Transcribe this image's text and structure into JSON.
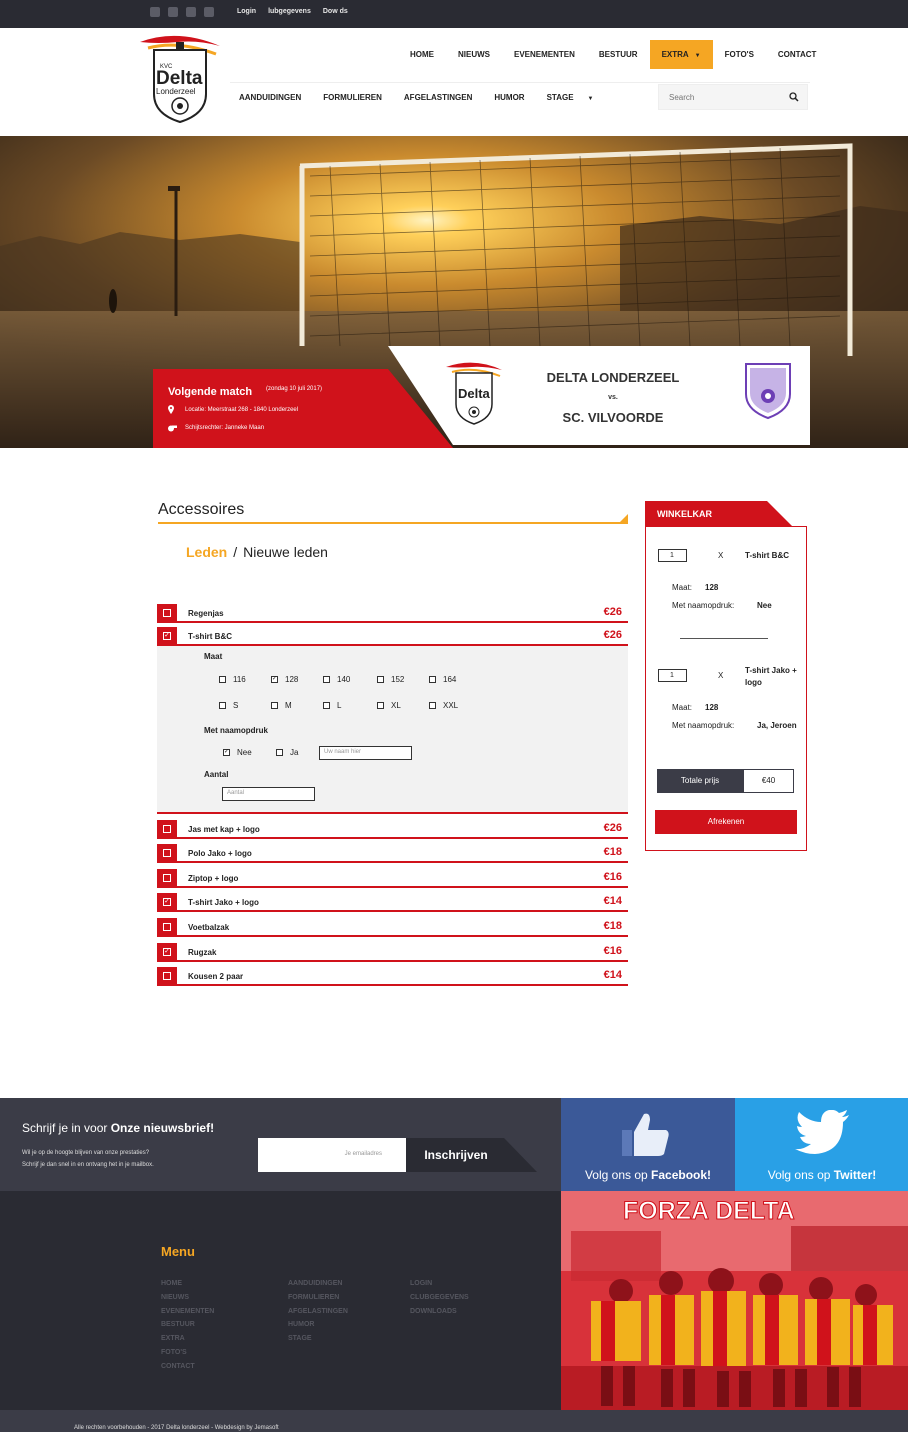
{
  "topbar": {
    "social": [
      "facebook-icon",
      "twitter-icon",
      "instagram-icon",
      "youtube-icon"
    ],
    "links": [
      "Login",
      "lubgegevens",
      "Dow   ds"
    ]
  },
  "nav": {
    "main": [
      "HOME",
      "NIEUWS",
      "EVENEMENTEN",
      "BESTUUR",
      "EXTRA",
      "FOTO'S",
      "CONTACT"
    ],
    "active": "EXTRA",
    "sub": [
      "AANDUIDINGEN",
      "FORMULIEREN",
      "AFGELASTINGEN",
      "HUMOR",
      "STAGE"
    ]
  },
  "search": {
    "placeholder": "Search"
  },
  "logo": {
    "kvc": "KVC",
    "name": "Delta",
    "city": "Londerzeel"
  },
  "match": {
    "title": "Volgende match",
    "date": "(zondag 10 juli 2017)",
    "location": "Locatie: Meerstraat 268 - 1840 Londerzeel",
    "referee": "Schijtsrechter: Janneke Maan",
    "home": "DELTA LONDERZEEL",
    "vs": "vs.",
    "away": "SC. VILVOORDE"
  },
  "section": {
    "title": "Accessoires",
    "breadcrumb": [
      "Leden",
      "/",
      "Nieuwe leden"
    ]
  },
  "products": [
    {
      "name": "Regenjas",
      "price": "€26",
      "checked": false
    },
    {
      "name": "T-shirt B&C",
      "price": "€26",
      "checked": true
    },
    {
      "name": "Jas met kap + logo",
      "price": "€26",
      "checked": false
    },
    {
      "name": "Polo Jako + logo",
      "price": "€18",
      "checked": false
    },
    {
      "name": "Ziptop + logo",
      "price": "€16",
      "checked": false
    },
    {
      "name": "T-shirt Jako + logo",
      "price": "€14",
      "checked": true
    },
    {
      "name": "Voetbalzak",
      "price": "€18",
      "checked": false
    },
    {
      "name": "Rugzak",
      "price": "€16",
      "checked": true
    },
    {
      "name": "Kousen 2 paar",
      "price": "€14",
      "checked": false
    }
  ],
  "options": {
    "maat_label": "Maat",
    "sizes_row1": [
      "116",
      "128",
      "140",
      "152",
      "164"
    ],
    "sizes_row2": [
      "S",
      "M",
      "L",
      "XL",
      "XXL"
    ],
    "selected_size": "128",
    "naam_label": "Met naamopdruk",
    "nee": "Nee",
    "ja": "Ja",
    "naam_placeholder": "Uw naam hier",
    "aantal_label": "Aantal",
    "aantal_placeholder": "Aantal"
  },
  "cart": {
    "title": "WINKELKAR",
    "items": [
      {
        "qty": "1",
        "x": "X",
        "name": "T-shirt B&C",
        "maat_label": "Maat:",
        "maat": "128",
        "naam_label": "Met naamopdruk:",
        "naam": "Nee"
      },
      {
        "qty": "1",
        "x": "X",
        "name": "T-shirt Jako + logo",
        "maat_label": "Maat:",
        "maat": "128",
        "naam_label": "Met naamopdruk:",
        "naam": "Ja, Jeroen"
      }
    ],
    "total_label": "Totale prijs",
    "total": "€40",
    "checkout": "Afrekenen"
  },
  "newsletter": {
    "title_pre": "Schrijf je in voor",
    "title_bold": "Onze nieuwsbrief!",
    "sub1": "Wil je op de hoogte blijven van onze prestaties?",
    "sub2": "Schrijf je dan snel in en ontvang het in je mailbox.",
    "placeholder": "Je emailadres",
    "button": "Inschrijven"
  },
  "social_blocks": {
    "fb_pre": "Volg ons op",
    "fb_bold": "Facebook!",
    "tw_pre": "Volg ons op",
    "tw_bold": "Twitter!"
  },
  "footer": {
    "menu_title": "Menu",
    "col1": [
      "HOME",
      "NIEUWS",
      "EVENEMENTEN",
      "BESTUUR",
      "EXTRA",
      "FOTO'S",
      "CONTACT"
    ],
    "col2": [
      "AANDUIDINGEN",
      "FORMULIEREN",
      "AFGELASTINGEN",
      "HUMOR",
      "STAGE"
    ],
    "col3": [
      "LOGIN",
      "CLUBGEGEVENS",
      "DOWNLOADS"
    ],
    "forza": "FORZA DELTA",
    "copyright": "Alle rechten voorbehouden - 2017 Delta londerzeel - Webdesign by Jemasoft"
  },
  "colors": {
    "accent": "#f5a623",
    "red": "#d0121b",
    "dark": "#2a2b33",
    "facebook": "#3b5998",
    "twitter": "#29a0e6"
  }
}
